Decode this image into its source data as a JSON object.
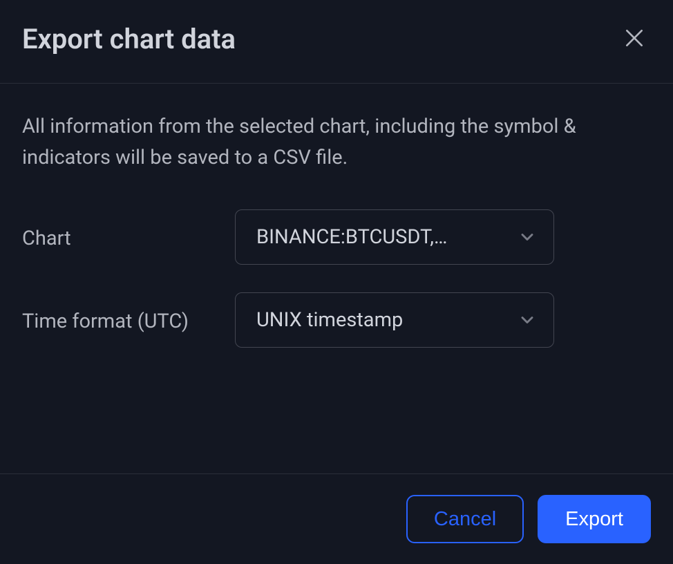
{
  "dialog": {
    "title": "Export chart data",
    "description": "All information from the selected chart, including the symbol & indicators will be saved to a CSV file.",
    "fields": {
      "chart": {
        "label": "Chart",
        "value": "BINANCE:BTCUSDT,…"
      },
      "time_format": {
        "label": "Time format (UTC)",
        "value": "UNIX timestamp"
      }
    },
    "buttons": {
      "cancel": "Cancel",
      "export": "Export"
    }
  }
}
